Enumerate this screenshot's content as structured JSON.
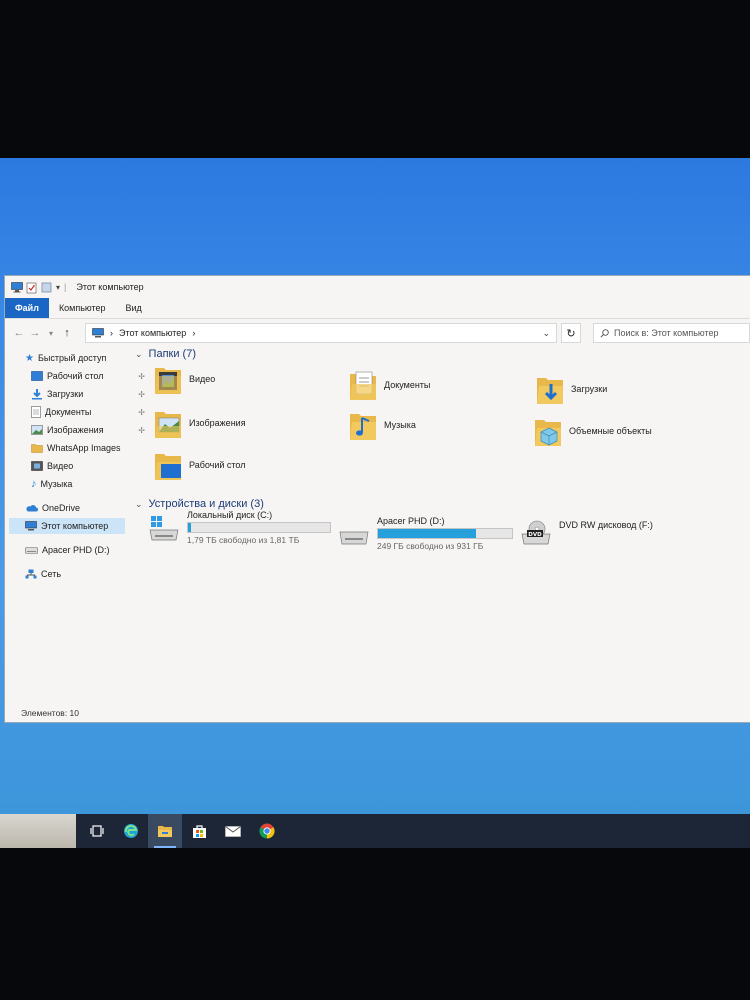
{
  "window": {
    "title": "Этот компьютер",
    "ribbon_tabs": [
      "Файл",
      "Компьютер",
      "Вид"
    ],
    "breadcrumb": "Этот компьютер",
    "breadcrumb_sep": "›",
    "search_placeholder": "Поиск в: Этот компьютер"
  },
  "nav": {
    "quick_access": "Быстрый доступ",
    "items": [
      {
        "label": "Рабочий стол",
        "pinned": true
      },
      {
        "label": "Загрузки",
        "pinned": true
      },
      {
        "label": "Документы",
        "pinned": true
      },
      {
        "label": "Изображения",
        "pinned": true
      },
      {
        "label": "WhatsApp Images",
        "pinned": false
      },
      {
        "label": "Видео",
        "pinned": false
      },
      {
        "label": "Музыка",
        "pinned": false
      }
    ],
    "onedrive": "OneDrive",
    "this_pc": "Этот компьютер",
    "apacer": "Apacer PHD (D:)",
    "network": "Сеть"
  },
  "folders": {
    "header": "Папки (7)",
    "items": [
      "Видео",
      "Документы",
      "Загрузки",
      "Изображения",
      "Музыка",
      "Объемные объекты",
      "Рабочий стол"
    ]
  },
  "drives": {
    "header": "Устройства и диски (3)",
    "items": [
      {
        "name": "Локальный диск (C:)",
        "free": "1,79 ТБ свободно из 1,81 ТБ",
        "used_fraction": 0.02
      },
      {
        "name": "Apacer PHD (D:)",
        "free": "249 ГБ свободно из 931 ГБ",
        "used_fraction": 0.73
      },
      {
        "name": "DVD RW дисковод (F:)",
        "dvd_label": "DVD"
      }
    ]
  },
  "status": "Элементов: 10",
  "colors": {
    "accent": "#1a66c4",
    "bar_fill": "#26a0da",
    "folder": "#e8b94a"
  }
}
